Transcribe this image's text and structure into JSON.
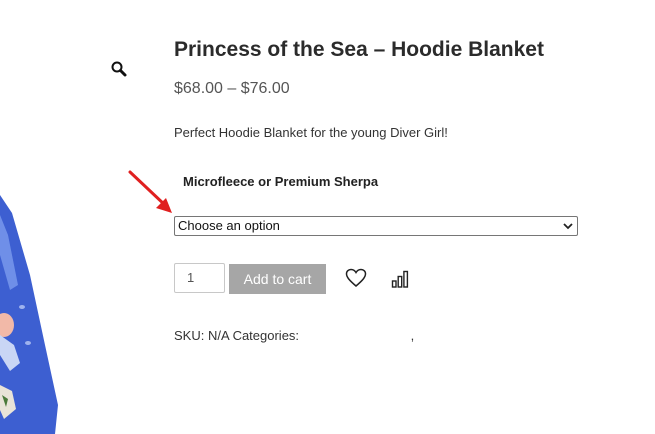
{
  "product": {
    "title": "Princess of the Sea – Hoodie Blanket",
    "price_range": "$68.00 – $76.00",
    "description": "Perfect Hoodie Blanket for the young Diver Girl!",
    "variation_label": "Microfleece or Premium Sherpa",
    "variation_selected": "Choose an option",
    "quantity": "1",
    "add_to_cart_label": "Add to cart",
    "sku_label": "SKU:",
    "sku_value": "N/A",
    "categories_label": "Categories:",
    "categories_separator": ","
  },
  "icons": {
    "zoom": "magnifier-icon",
    "wishlist": "heart-icon",
    "compare": "bar-chart-icon",
    "annotation": "red-arrow"
  },
  "colors": {
    "annotation_arrow": "#e02020",
    "button_bg": "#a6a6a6"
  }
}
